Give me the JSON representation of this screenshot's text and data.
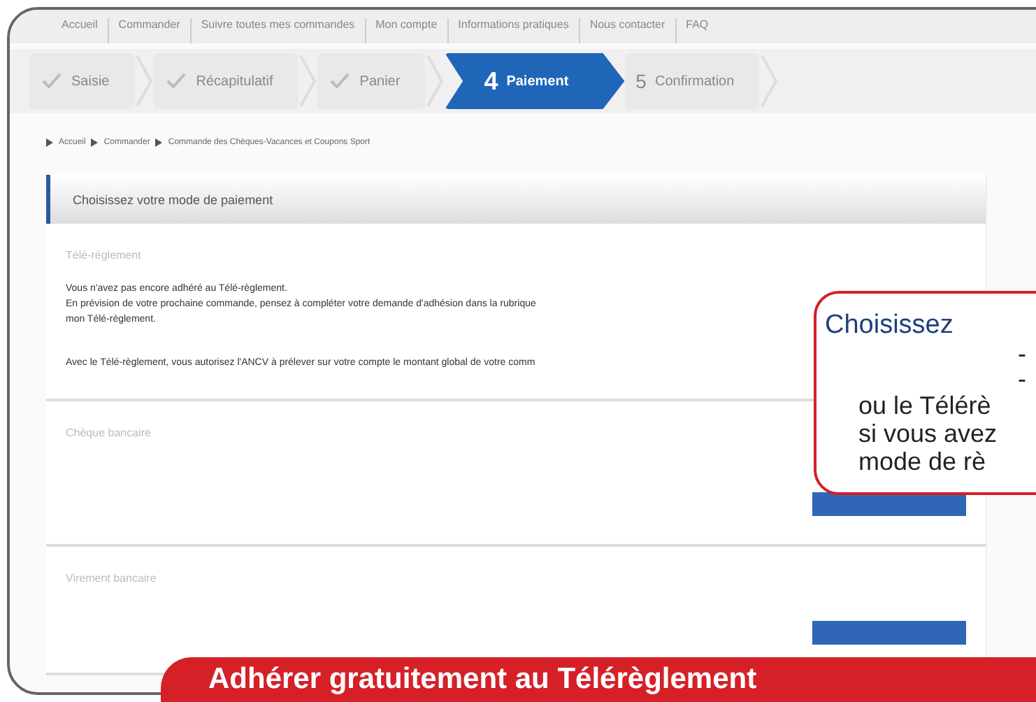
{
  "top_nav": [
    "Accueil",
    "Commander",
    "Suivre toutes mes commandes",
    "Mon compte",
    "Informations pratiques",
    "Nous contacter",
    "FAQ"
  ],
  "steps": [
    {
      "label": "Saisie",
      "completed": true,
      "selected": false
    },
    {
      "label": "Récapitulatif",
      "completed": true,
      "selected": false
    },
    {
      "label": "Panier",
      "completed": true,
      "selected": false
    },
    {
      "number": "4",
      "label": "Paiement",
      "completed": false,
      "selected": true
    },
    {
      "number": "5",
      "label": "Confirmation",
      "completed": false,
      "selected": false
    }
  ],
  "breadcrumb": [
    "Accueil",
    "Commander",
    "Commande des Chèques-Vacances et Coupons Sport"
  ],
  "panel": {
    "title": "Choisissez votre mode de paiement",
    "sections": [
      {
        "kind": "info",
        "title": "Télé-règlement",
        "paragraphs": [
          "Vous n'avez pas encore adhéré au Télé-règlement.",
          "En prévision de votre prochaine commande, pensez à compléter votre demande d'adhésion dans la rubrique",
          "mon Télé-règlement.",
          "Avec le Télé-règlement, vous autorisez l'ANCV à prélever sur votre compte le montant global de votre comm"
        ]
      },
      {
        "kind": "option",
        "title": "Chèque bancaire"
      },
      {
        "kind": "option",
        "title": "Virement bancaire"
      }
    ]
  },
  "callout": {
    "title": "Choisissez",
    "bullets": [
      "-",
      "-"
    ],
    "lines": [
      "ou le Télérè",
      "si vous avez",
      "mode de rè"
    ]
  },
  "banner": {
    "text": "Adhérer gratuitement au Télérèglement"
  }
}
